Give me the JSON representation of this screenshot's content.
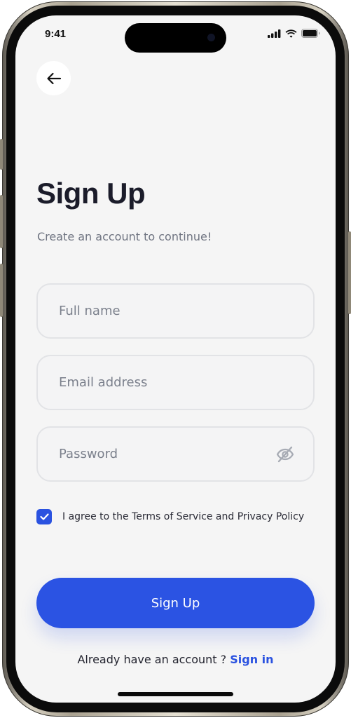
{
  "status_bar": {
    "time": "9:41",
    "icons": [
      "signal-icon",
      "wifi-icon",
      "battery-icon"
    ]
  },
  "header": {
    "back_icon": "arrow-left-icon"
  },
  "page": {
    "title": "Sign Up",
    "subtitle": "Create an account to continue!"
  },
  "form": {
    "full_name": {
      "value": "",
      "placeholder": "Full name"
    },
    "email": {
      "value": "",
      "placeholder": "Email address"
    },
    "password": {
      "value": "",
      "placeholder": "Password",
      "toggle_icon": "eye-off-icon"
    },
    "agree": {
      "checked": true,
      "label": "I agree to the Terms of Service and Privacy Policy"
    },
    "submit_label": "Sign Up"
  },
  "footer": {
    "prompt": "Already have an account ? ",
    "link_label": "Sign in"
  },
  "colors": {
    "accent": "#2b53e3",
    "background": "#f5f5f5",
    "title": "#1b1c2a",
    "muted": "#6f7481"
  }
}
